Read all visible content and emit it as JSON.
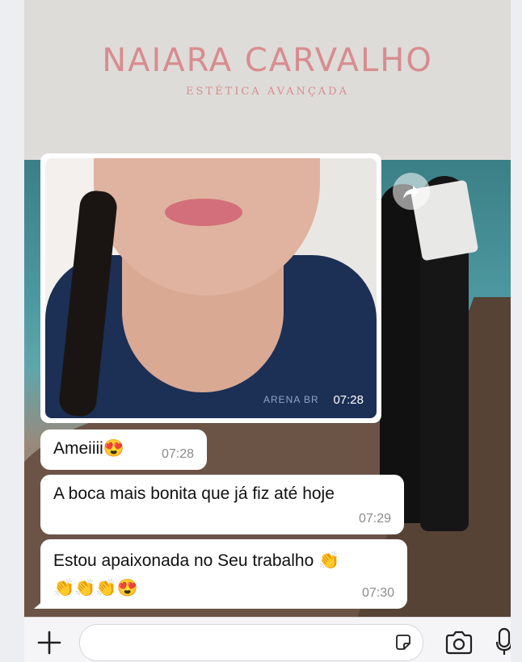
{
  "header": {
    "brand_name": "NAIARA CARVALHO",
    "brand_subtitle": "ESTÉTICA AVANÇADA"
  },
  "chat": {
    "photo_message": {
      "time": "07:28",
      "shirt_print": "ARENA BR"
    },
    "messages": [
      {
        "text": "Ameiiii😍",
        "time": "07:28"
      },
      {
        "text": "A boca mais bonita que já fiz até hoje",
        "time": "07:29"
      },
      {
        "text_line1": "Estou apaixonada no Seu trabalho 👏",
        "text_line2": "👏👏👏😍",
        "time": "07:30"
      }
    ]
  },
  "icons": {
    "forward": "forward-arrow-icon",
    "plus": "plus-icon",
    "sticker": "sticker-icon",
    "camera": "camera-icon",
    "mic": "microphone-icon"
  },
  "colors": {
    "brand": "#d88c8f",
    "bubble": "#ffffff",
    "time_text": "#8b8b8b"
  }
}
